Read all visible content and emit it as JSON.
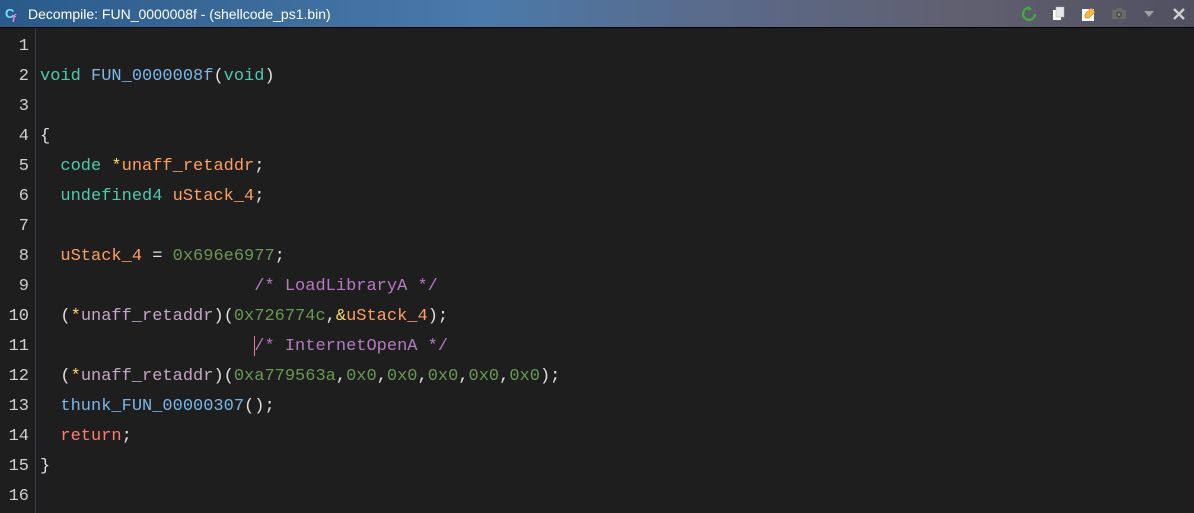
{
  "titlebar": {
    "title": "Decompile: FUN_0000008f -  (shellcode_ps1.bin)"
  },
  "code": {
    "lines": [
      {
        "n": 1,
        "tokens": []
      },
      {
        "n": 2,
        "tokens": [
          {
            "t": "void ",
            "c": "tok-type"
          },
          {
            "t": "FUN_0000008f",
            "c": "tok-fn"
          },
          {
            "t": "(",
            "c": "tok-punc"
          },
          {
            "t": "void",
            "c": "tok-type"
          },
          {
            "t": ")",
            "c": "tok-punc"
          }
        ]
      },
      {
        "n": 3,
        "tokens": []
      },
      {
        "n": 4,
        "tokens": [
          {
            "t": "{",
            "c": "tok-punc"
          }
        ]
      },
      {
        "n": 5,
        "tokens": [
          {
            "t": "  ",
            "c": ""
          },
          {
            "t": "code ",
            "c": "tok-type"
          },
          {
            "t": "*",
            "c": "tok-ptr"
          },
          {
            "t": "unaff_retaddr",
            "c": "tok-var"
          },
          {
            "t": ";",
            "c": "tok-punc"
          }
        ]
      },
      {
        "n": 6,
        "tokens": [
          {
            "t": "  ",
            "c": ""
          },
          {
            "t": "undefined4 ",
            "c": "tok-type"
          },
          {
            "t": "uStack_4",
            "c": "tok-var"
          },
          {
            "t": ";",
            "c": "tok-punc"
          }
        ]
      },
      {
        "n": 7,
        "tokens": []
      },
      {
        "n": 8,
        "tokens": [
          {
            "t": "  ",
            "c": ""
          },
          {
            "t": "uStack_4 ",
            "c": "tok-var"
          },
          {
            "t": "= ",
            "c": "tok-punc"
          },
          {
            "t": "0x696e6977",
            "c": "tok-num"
          },
          {
            "t": ";",
            "c": "tok-punc"
          }
        ]
      },
      {
        "n": 9,
        "tokens": [
          {
            "t": "                     ",
            "c": ""
          },
          {
            "t": "/* LoadLibraryA */",
            "c": "tok-comment"
          }
        ]
      },
      {
        "n": 10,
        "tokens": [
          {
            "t": "  ",
            "c": ""
          },
          {
            "t": "(",
            "c": "tok-punc"
          },
          {
            "t": "*",
            "c": "tok-ptr"
          },
          {
            "t": "unaff_retaddr",
            "c": "tok-fn2"
          },
          {
            "t": ")(",
            "c": "tok-punc"
          },
          {
            "t": "0x726774c",
            "c": "tok-num"
          },
          {
            "t": ",",
            "c": "tok-punc"
          },
          {
            "t": "&",
            "c": "tok-ptr"
          },
          {
            "t": "uStack_4",
            "c": "tok-var"
          },
          {
            "t": ");",
            "c": "tok-punc"
          }
        ]
      },
      {
        "n": 11,
        "tokens": [
          {
            "t": "                     ",
            "c": ""
          },
          {
            "t": "/",
            "c": "tok-comment",
            "cursor": true
          },
          {
            "t": "* InternetOpenA */",
            "c": "tok-comment"
          }
        ]
      },
      {
        "n": 12,
        "tokens": [
          {
            "t": "  ",
            "c": ""
          },
          {
            "t": "(",
            "c": "tok-punc"
          },
          {
            "t": "*",
            "c": "tok-ptr"
          },
          {
            "t": "unaff_retaddr",
            "c": "tok-fn2"
          },
          {
            "t": ")(",
            "c": "tok-punc"
          },
          {
            "t": "0xa779563a",
            "c": "tok-num"
          },
          {
            "t": ",",
            "c": "tok-punc"
          },
          {
            "t": "0x0",
            "c": "tok-num"
          },
          {
            "t": ",",
            "c": "tok-punc"
          },
          {
            "t": "0x0",
            "c": "tok-num"
          },
          {
            "t": ",",
            "c": "tok-punc"
          },
          {
            "t": "0x0",
            "c": "tok-num"
          },
          {
            "t": ",",
            "c": "tok-punc"
          },
          {
            "t": "0x0",
            "c": "tok-num"
          },
          {
            "t": ",",
            "c": "tok-punc"
          },
          {
            "t": "0x0",
            "c": "tok-num"
          },
          {
            "t": ");",
            "c": "tok-punc"
          }
        ]
      },
      {
        "n": 13,
        "tokens": [
          {
            "t": "  ",
            "c": ""
          },
          {
            "t": "thunk_FUN_00000307",
            "c": "tok-fn"
          },
          {
            "t": "();",
            "c": "tok-punc"
          }
        ]
      },
      {
        "n": 14,
        "tokens": [
          {
            "t": "  ",
            "c": ""
          },
          {
            "t": "return",
            "c": "tok-kw"
          },
          {
            "t": ";",
            "c": "tok-punc"
          }
        ]
      },
      {
        "n": 15,
        "tokens": [
          {
            "t": "}",
            "c": "tok-punc"
          }
        ]
      },
      {
        "n": 16,
        "tokens": []
      }
    ]
  }
}
